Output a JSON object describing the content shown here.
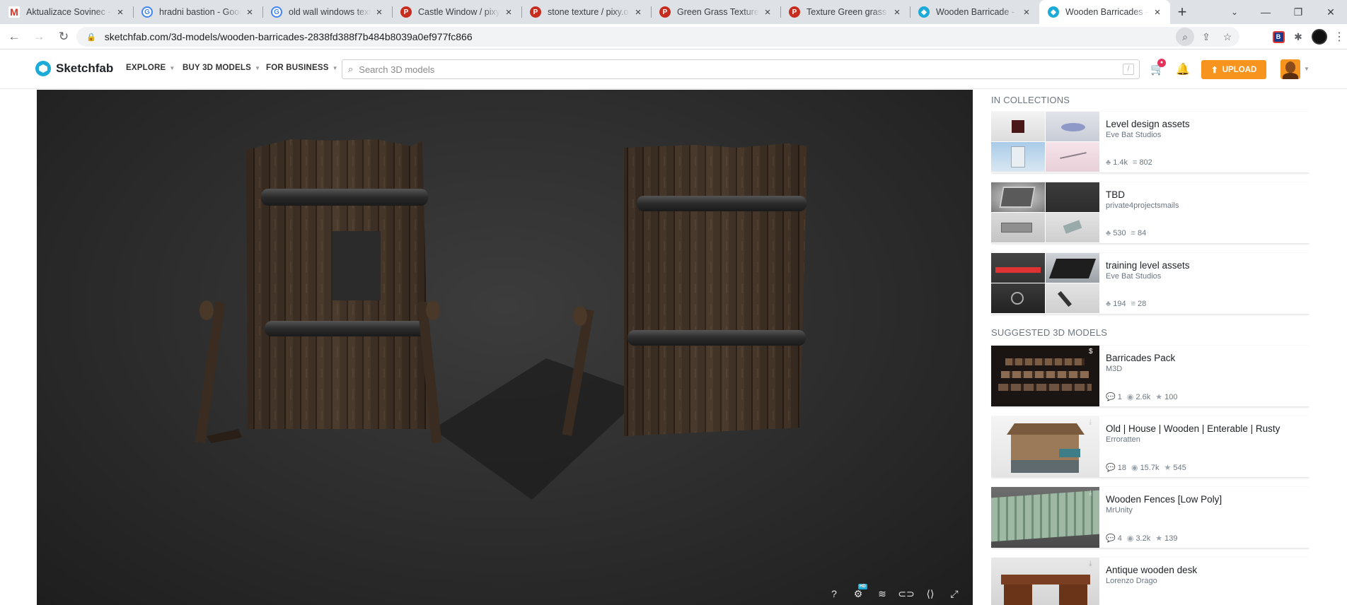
{
  "browser": {
    "tabs": [
      {
        "title": "Aktualizace Sovinec - Gmail",
        "favicon": "gmail-icon"
      },
      {
        "title": "hradni bastion - Google Search",
        "favicon": "google-icon"
      },
      {
        "title": "old wall windows texture",
        "favicon": "google-icon"
      },
      {
        "title": "Castle Window / pixy.org",
        "favicon": "pixy-icon"
      },
      {
        "title": "stone texture / pixy.org",
        "favicon": "pixy-icon"
      },
      {
        "title": "Green Grass Texture free",
        "favicon": "pixy-icon"
      },
      {
        "title": "Texture Green grass free",
        "favicon": "pixy-icon"
      },
      {
        "title": "Wooden Barricade - Download",
        "favicon": "sketchfab-icon"
      },
      {
        "title": "Wooden Barricades - Download",
        "favicon": "sketchfab-icon",
        "active": true
      }
    ],
    "url": "sketchfab.com/3d-models/wooden-barricades-2838fd388f7b484b8039a0ef977fc866",
    "extension_label": "B"
  },
  "site": {
    "logo": "Sketchfab",
    "nav": [
      "EXPLORE",
      "BUY 3D MODELS",
      "FOR BUSINESS"
    ],
    "search_placeholder": "Search 3D models",
    "search_shortcut": "/",
    "cart_badge": "●",
    "upload_label": "UPLOAD",
    "accent": "#1caad9",
    "upload_color": "#f7941d"
  },
  "collections": {
    "title": "IN COLLECTIONS",
    "items": [
      {
        "name": "Level design assets",
        "author": "Eve Bat Studios",
        "likes": "1.4k",
        "models": "802"
      },
      {
        "name": "TBD",
        "author": "private4projectsmails",
        "likes": "530",
        "models": "84"
      },
      {
        "name": "training level assets",
        "author": "Eve Bat Studios",
        "likes": "194",
        "models": "28"
      }
    ]
  },
  "suggested": {
    "title": "SUGGESTED 3D MODELS",
    "items": [
      {
        "name": "Barricades Pack",
        "author": "M3D",
        "comments": "1",
        "views": "2.6k",
        "likes": "100",
        "badge": "$"
      },
      {
        "name": "Old | House | Wooden | Enterable | Rusty",
        "author": "Erroratten",
        "comments": "18",
        "views": "15.7k",
        "likes": "545",
        "badge": "⤓"
      },
      {
        "name": "Wooden Fences [Low Poly]",
        "author": "MrUnity",
        "comments": "4",
        "views": "3.2k",
        "likes": "139",
        "badge": "⤓"
      },
      {
        "name": "Antique wooden desk",
        "author": "Lorenzo Drago",
        "badge": "⤓"
      }
    ]
  },
  "viewer": {
    "hd_label": "HD"
  }
}
